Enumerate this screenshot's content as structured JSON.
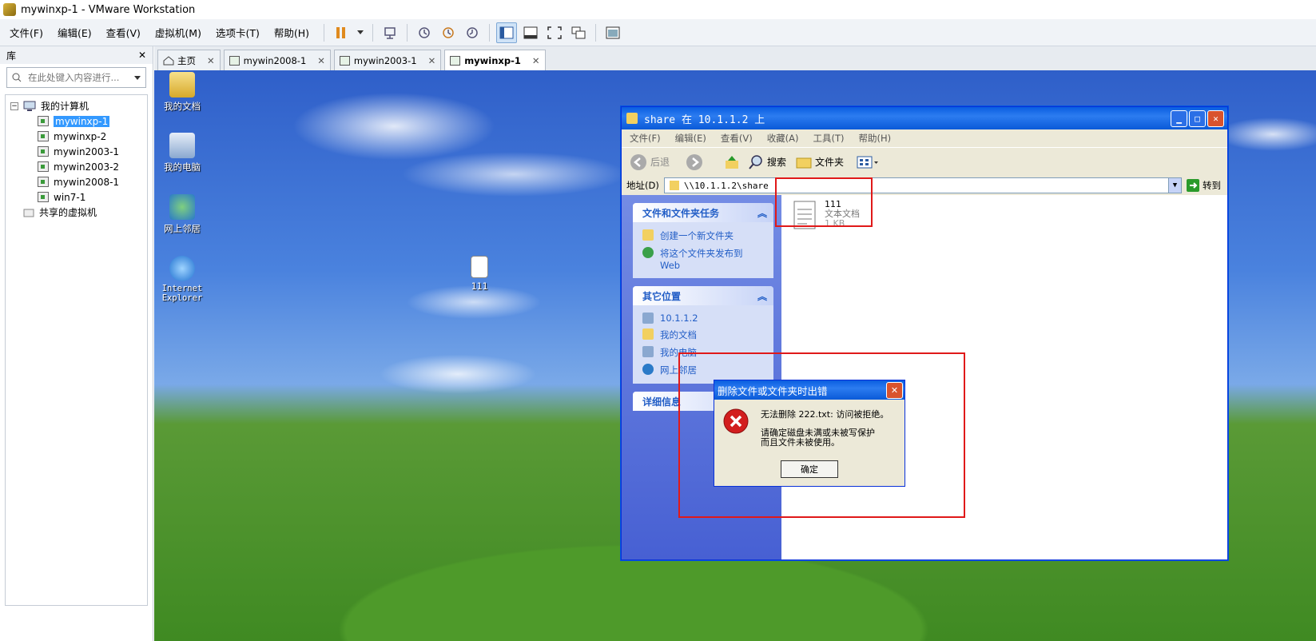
{
  "window": {
    "title": "mywinxp-1 - VMware Workstation"
  },
  "menubar": [
    "文件(F)",
    "编辑(E)",
    "查看(V)",
    "虚拟机(M)",
    "选项卡(T)",
    "帮助(H)"
  ],
  "library": {
    "title": "库",
    "close": "✕",
    "search_placeholder": "在此处键入内容进行...",
    "root": "我的计算机",
    "vms": [
      "mywinxp-1",
      "mywinxp-2",
      "mywin2003-1",
      "mywin2003-2",
      "mywin2008-1",
      "win7-1"
    ],
    "shared": "共享的虚拟机"
  },
  "tabs": [
    {
      "label": "主页",
      "close": "✕"
    },
    {
      "label": "mywin2008-1",
      "close": "✕"
    },
    {
      "label": "mywin2003-1",
      "close": "✕"
    },
    {
      "label": "mywinxp-1",
      "close": "✕"
    }
  ],
  "desktop": {
    "icons": [
      "我的文档",
      "我的电脑",
      "网上邻居",
      "Internet Explorer",
      "111"
    ]
  },
  "explorer": {
    "title": "share 在 10.1.1.2 上",
    "menu": [
      "文件(F)",
      "编辑(E)",
      "查看(V)",
      "收藏(A)",
      "工具(T)",
      "帮助(H)"
    ],
    "toolbar": {
      "back": "后退",
      "search": "搜索",
      "folders": "文件夹"
    },
    "address": {
      "label": "地址(D)",
      "value": "\\\\10.1.1.2\\share",
      "go": "转到"
    },
    "tasks": {
      "title": "文件和文件夹任务",
      "items": [
        "创建一个新文件夹",
        "将这个文件夹发布到 Web"
      ]
    },
    "places": {
      "title": "其它位置",
      "items": [
        "10.1.1.2",
        "我的文档",
        "我的电脑",
        "网上邻居"
      ]
    },
    "details": {
      "title": "详细信息"
    },
    "file": {
      "name": "111",
      "type": "文本文档",
      "size": "1 KB"
    }
  },
  "error_dialog": {
    "title": "删除文件或文件夹时出错",
    "message": "无法删除 222.txt: 访问被拒绝。",
    "detail": "请确定磁盘未满或未被写保护\n而且文件未被使用。",
    "ok": "确定"
  }
}
